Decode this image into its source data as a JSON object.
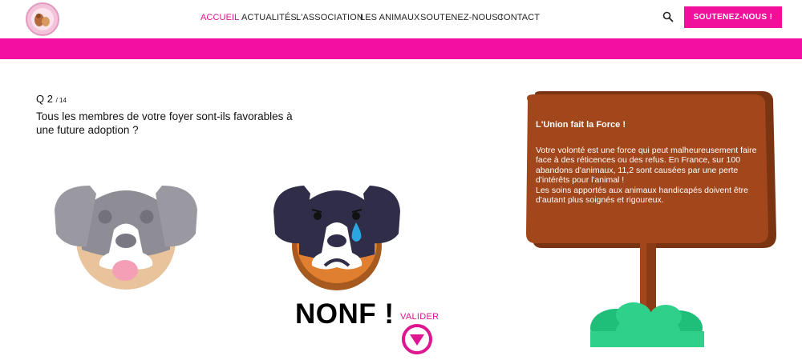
{
  "header": {
    "logo_name": "paw-logo",
    "nav": [
      "ACCUEIL",
      "ACTUALITÉS",
      "L'ASSOCIATION",
      "LES ANIMAUX",
      "SOUTENEZ-NOUS !",
      "CONTACT"
    ],
    "active_nav": "ACCUEIL",
    "cta_label": "SOUTENEZ-NOUS !",
    "search_icon": "search-icon"
  },
  "colors": {
    "accent": "#f40fa3",
    "sign_brown": "#a2461b",
    "sign_shadow": "#7a3412",
    "bush_green": "#2fd089"
  },
  "question": {
    "number": "Q 2",
    "total": "/ 14",
    "text": "Tous les membres de votre foyer sont-ils favorables à une future adoption ?"
  },
  "answers": {
    "selected_label": "NONF !",
    "happy_icon": "happy-dog-icon",
    "sad_icon": "sad-dog-icon"
  },
  "validate": {
    "label": "VALIDER",
    "icon": "down-arrow-circle-icon"
  },
  "sign": {
    "title": "L'Union fait la Force !",
    "body": "Votre volonté est une force qui peut malheureusement faire face à des réticences ou des refus. En France, sur 100 abandons d'animaux, 11,2 sont causées par une perte d'intérêts pour l'animal !\nLes soins apportés aux animaux handicapés doivent être d'autant plus soignés et rigoureux."
  }
}
